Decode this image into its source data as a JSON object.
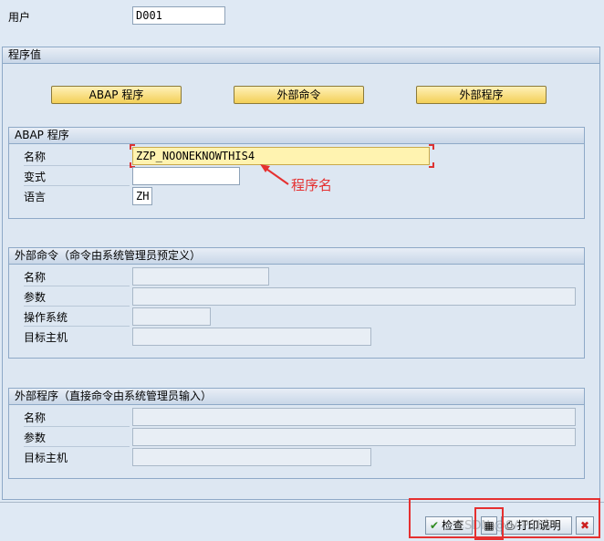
{
  "user": {
    "label": "用户",
    "value": "D001"
  },
  "program_values": {
    "title": "程序值",
    "buttons": {
      "abap": "ABAP 程序",
      "ext_cmd": "外部命令",
      "ext_prog": "外部程序"
    }
  },
  "abap_group": {
    "title": "ABAP 程序",
    "name_label": "名称",
    "name_value": "ZZP_NOONEKNOWTHIS4",
    "variant_label": "变式",
    "variant_value": "",
    "language_label": "语言",
    "language_value": "ZH"
  },
  "annotation": {
    "text": "程序名",
    "color": "#e53030"
  },
  "ext_cmd_group": {
    "title": "外部命令（命令由系统管理员预定义）",
    "name_label": "名称",
    "params_label": "参数",
    "os_label": "操作系统",
    "host_label": "目标主机"
  },
  "ext_prog_group": {
    "title": "外部程序（直接命令由系统管理员输入）",
    "name_label": "名称",
    "params_label": "参数",
    "host_label": "目标主机"
  },
  "toolbar": {
    "check_label": "检查",
    "print_label": "打印说明",
    "icons": [
      "check-icon",
      "save-icon",
      "print-icon",
      "cancel-icon"
    ],
    "watermark": "CSDN @SAP剑客"
  },
  "colors": {
    "accent_button": "#f3cf57",
    "highlight_field": "#fff3b0",
    "annotation_red": "#e53030"
  }
}
